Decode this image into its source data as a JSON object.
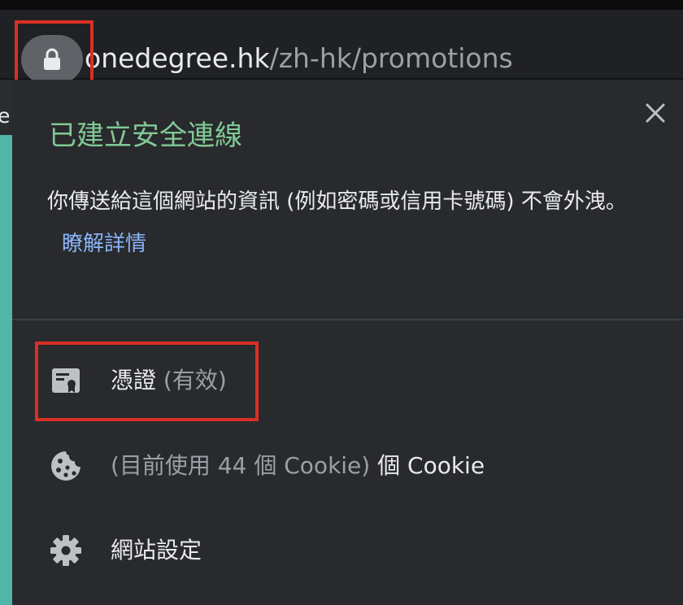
{
  "address_bar": {
    "host": "onedegree.hk",
    "path": "/zh-hk/promotions",
    "lock_icon": "lock-icon"
  },
  "page_edge_text": "e",
  "popup": {
    "title": "已建立安全連線",
    "description": "你傳送給這個網站的資訊 (例如密碼或信用卡號碼) 不會外洩。",
    "learn_more_link": "瞭解詳情",
    "close_icon": "close-icon"
  },
  "rows": {
    "certificate": {
      "label": "憑證",
      "status": "(有效)",
      "icon": "certificate-icon"
    },
    "cookies": {
      "label_muted": "(目前使用 44 個 Cookie)",
      "label": "個 Cookie",
      "icon": "cookie-icon"
    },
    "site_settings": {
      "label": "網站設定",
      "icon": "gear-icon"
    }
  },
  "colors": {
    "title_green": "#81c995",
    "link_blue": "#8ab4f8",
    "highlight_red": "#d93025",
    "popup_bg": "#292a2d"
  }
}
